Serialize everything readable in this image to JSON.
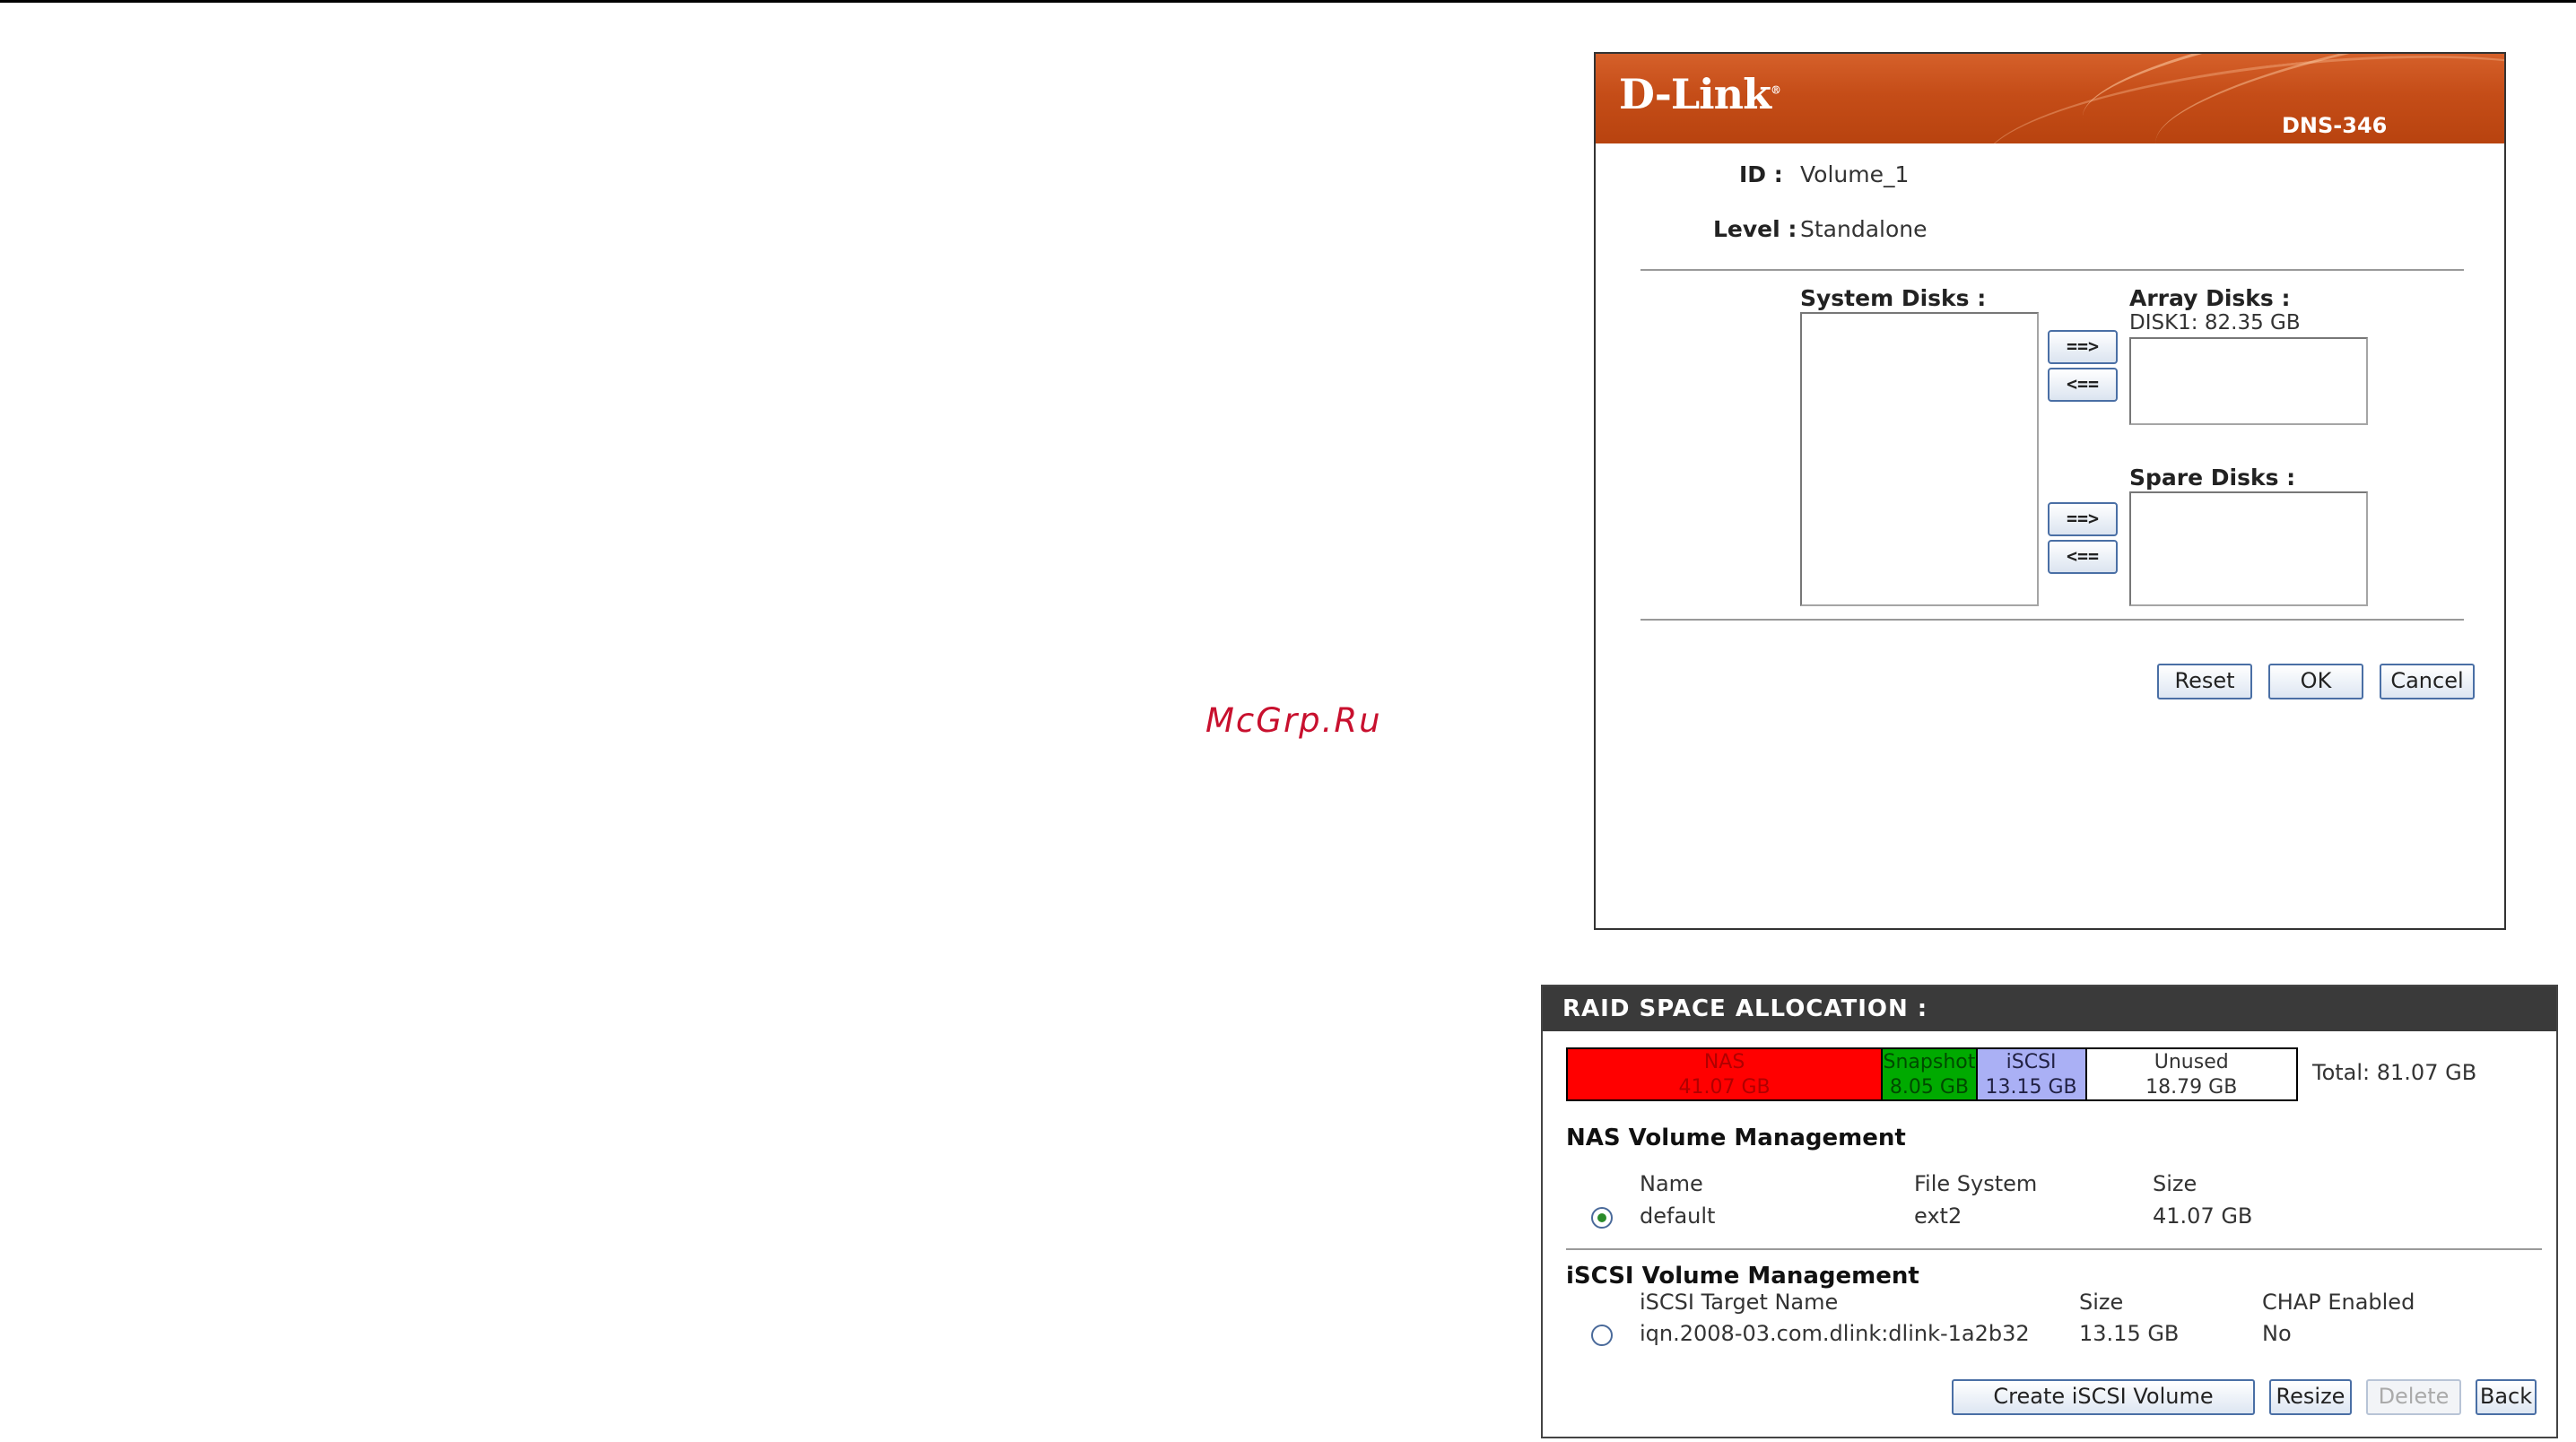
{
  "watermark": "McGrp.Ru",
  "header": {
    "brand": "D-Link",
    "model": "DNS-346"
  },
  "volume": {
    "id_label": "ID :",
    "id_value": "Volume_1",
    "level_label": "Level :",
    "level_value": "Standalone"
  },
  "disks": {
    "system_label": "System Disks :",
    "system_items": [],
    "array_label": "Array Disks :",
    "array_items": [
      "DISK1: 82.35 GB"
    ],
    "spare_label": "Spare Disks :",
    "spare_items": [],
    "add_label": "==>",
    "remove_label": "<=="
  },
  "dialog_buttons": {
    "reset": "Reset",
    "ok": "OK",
    "cancel": "Cancel"
  },
  "raid": {
    "title": "RAID SPACE ALLOCATION :",
    "segments": [
      {
        "name": "NAS",
        "size": "41.07 GB",
        "fraction": 0.43,
        "color": "#ff0000",
        "text_color": "#b00000"
      },
      {
        "name": "Snapshot",
        "size": "8.05 GB",
        "fraction": 0.13,
        "color": "#00aa00",
        "text_color": "#004a00"
      },
      {
        "name": "iSCSI",
        "size": "13.15 GB",
        "fraction": 0.15,
        "color": "#aab0f5",
        "text_color": "#222244"
      },
      {
        "name": "Unused",
        "size": "18.79 GB",
        "fraction": 0.29,
        "color": "#ffffff",
        "text_color": "#333333"
      }
    ],
    "total": "Total: 81.07 GB"
  },
  "nas": {
    "title": "NAS Volume Management",
    "columns": [
      "Name",
      "File System",
      "Size"
    ],
    "rows": [
      {
        "name": "default",
        "fs": "ext2",
        "size": "41.07 GB",
        "selected": true
      }
    ]
  },
  "iscsi": {
    "title": "iSCSI Volume Management",
    "columns": [
      "iSCSI Target Name",
      "Size",
      "CHAP Enabled"
    ],
    "rows": [
      {
        "target": "iqn.2008-03.com.dlink:dlink-1a2b32",
        "size": "13.15 GB",
        "chap": "No",
        "selected": false
      }
    ]
  },
  "bottom_buttons": {
    "create": "Create iSCSI Volume",
    "resize": "Resize",
    "delete": "Delete",
    "back": "Back"
  }
}
